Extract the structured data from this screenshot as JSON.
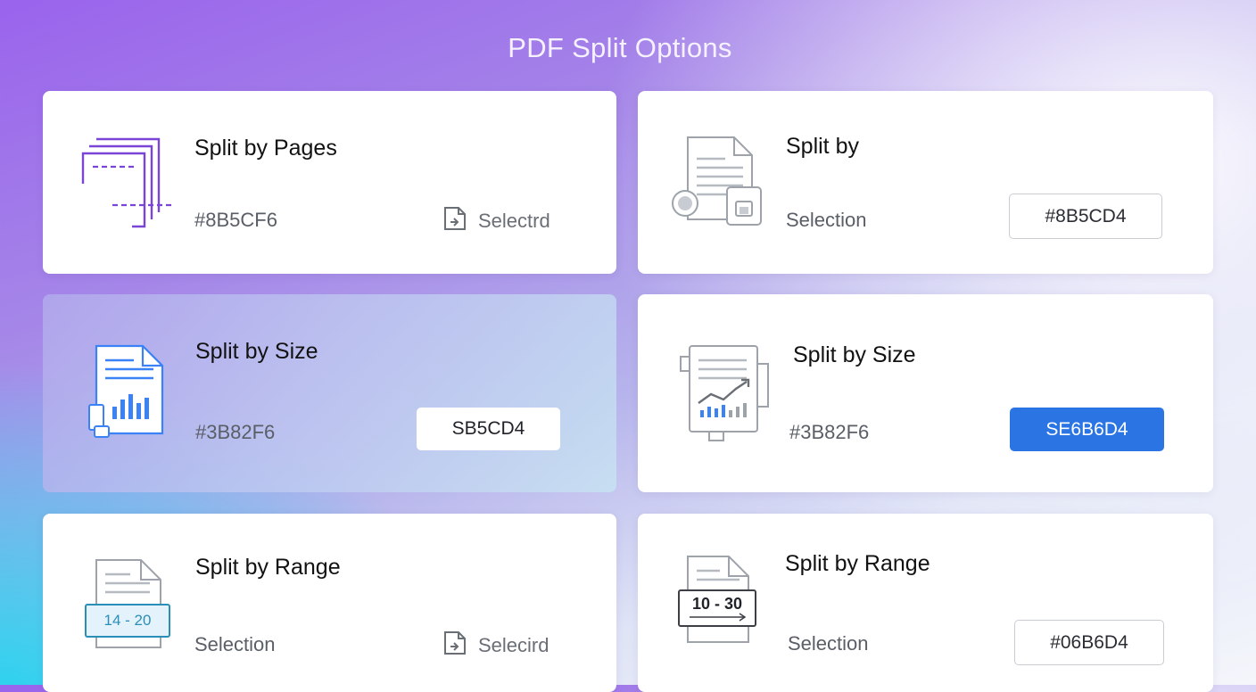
{
  "page": {
    "title": "PDF Split Options"
  },
  "cards": [
    {
      "heading": "Split by Pages",
      "sub": "#8B5CF6",
      "action_label": "Selectrd"
    },
    {
      "heading": "Split by",
      "sub": "Selection",
      "button_label": "#8B5CD4"
    },
    {
      "heading": "Split by Size",
      "sub": "#3B82F6",
      "button_label": "SB5CD4"
    },
    {
      "heading": "Split by Size",
      "sub": "#3B82F6",
      "button_label": "SE6B6D4"
    },
    {
      "heading": "Split by Range",
      "sub": "Selection",
      "action_label": "Selecird",
      "icon_text": "14 - 20"
    },
    {
      "heading": "Split by Range",
      "sub": "Selection",
      "button_label": "#06B6D4",
      "icon_text": "10 - 30"
    }
  ],
  "icons": {
    "card1": "stacked-pages-icon",
    "card2": "document-lock-icon",
    "card3": "document-bar-chart-icon",
    "card4": "document-trend-chart-icon",
    "card5": "document-range-icon",
    "card6": "document-range-icon",
    "action": "file-select-icon"
  },
  "colors": {
    "accent_purple": "#8B5CF6",
    "accent_blue": "#3B82F6",
    "primary_button": "#2B74E4",
    "range_teal": "#2A8FB8"
  }
}
